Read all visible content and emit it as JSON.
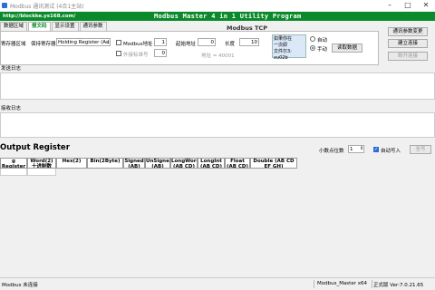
{
  "window": {
    "title": "Modbus 通讯测试 (4合1主站)"
  },
  "banner": {
    "url": "http://blockke.ys168.com/",
    "program": "Modbus Master 4 in 1 Utility Program"
  },
  "tabs": [
    "数据区域",
    "报文码",
    "显示设置",
    "通讯参数"
  ],
  "modbus": {
    "heading": "Modbus TCP",
    "area_label": "寄存器区域",
    "area_prefix": "保持寄存器",
    "area_value": "Holding Register (Ad",
    "modbus_addr_label": "Modbus地址",
    "modbus_addr_value": "1",
    "device_label": "外接标准号",
    "device_value": "0",
    "start_label": "起始地址",
    "start_value": "0",
    "length_label": "长度",
    "length_value": "10",
    "hint": "地址 = 40001",
    "send_text_1": "如果你在",
    "send_text_2": "一次即",
    "send_text_3": "文件尔3: xu02b",
    "auto_label": "自动",
    "manual_label": "手动",
    "read_button": "读取数据",
    "comm_button": "通讯参数变更",
    "connect_button": "建立连接",
    "disconnect_button": "断开连接"
  },
  "send_log": {
    "title": "发送日志"
  },
  "recv_log": {
    "title": "接收日志"
  },
  "output": {
    "title": "Output Register",
    "decimal_label": "小数点位数",
    "decimal_value": "1",
    "auto_write_label": "自动写入",
    "write_button": "全写",
    "columns": [
      "g Register",
      "Word(2) 十进制数",
      "Hex(2)",
      "Bin(2Byte)",
      "Signed (AB)",
      "UnSigned (AB)",
      "LongWord (AB CD)",
      "LongInt (AB CD)",
      "Float (AB CD)",
      "Double (AB CD EF GH)"
    ]
  },
  "status": {
    "connection": "Modbus 未连接",
    "app": "Modbus_Master x64",
    "version": "正式版 Ver:7.0.21.65"
  }
}
